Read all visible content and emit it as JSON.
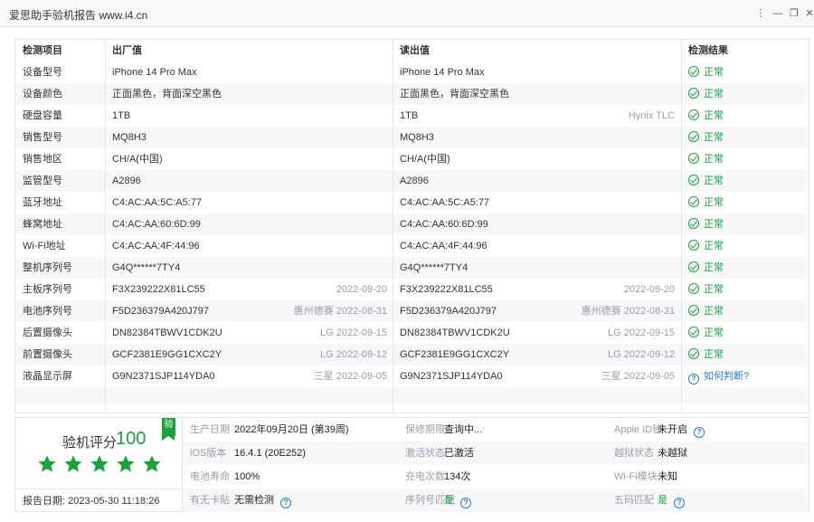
{
  "window": {
    "title": "爱思助手验机报告 www.i4.cn",
    "controls": [
      "⋮",
      "—",
      "❐",
      "✕"
    ]
  },
  "table": {
    "headers": {
      "item": "检测项目",
      "factory": "出厂值",
      "read": "读出值",
      "result": "检测结果"
    },
    "rows": [
      {
        "item": "设备型号",
        "factory": "iPhone 14 Pro Max",
        "factory_note": "",
        "read": "iPhone 14 Pro Max",
        "read_note": "",
        "result": "正常",
        "status": "ok"
      },
      {
        "item": "设备颜色",
        "factory": "正面黑色，背面深空黑色",
        "factory_note": "",
        "read": "正面黑色，背面深空黑色",
        "read_note": "",
        "result": "正常",
        "status": "ok"
      },
      {
        "item": "硬盘容量",
        "factory": "1TB",
        "factory_note": "",
        "read": "1TB",
        "read_note": "Hynix TLC",
        "result": "正常",
        "status": "ok"
      },
      {
        "item": "销售型号",
        "factory": "MQ8H3",
        "factory_note": "",
        "read": "MQ8H3",
        "read_note": "",
        "result": "正常",
        "status": "ok"
      },
      {
        "item": "销售地区",
        "factory": "CH/A(中国)",
        "factory_note": "",
        "read": "CH/A(中国)",
        "read_note": "",
        "result": "正常",
        "status": "ok"
      },
      {
        "item": "监管型号",
        "factory": "A2896",
        "factory_note": "",
        "read": "A2896",
        "read_note": "",
        "result": "正常",
        "status": "ok"
      },
      {
        "item": "蓝牙地址",
        "factory": "C4:AC:AA:5C:A5:77",
        "factory_note": "",
        "read": "C4:AC:AA:5C:A5:77",
        "read_note": "",
        "result": "正常",
        "status": "ok"
      },
      {
        "item": "蜂窝地址",
        "factory": "C4:AC:AA:60:6D:99",
        "factory_note": "",
        "read": "C4:AC:AA:60:6D:99",
        "read_note": "",
        "result": "正常",
        "status": "ok"
      },
      {
        "item": "Wi-Fi地址",
        "factory": "C4:AC:AA:4F:44:96",
        "factory_note": "",
        "read": "C4:AC:AA:4F:44:96",
        "read_note": "",
        "result": "正常",
        "status": "ok"
      },
      {
        "item": "整机序列号",
        "factory": "G4Q******7TY4",
        "factory_note": "",
        "read": "G4Q******7TY4",
        "read_note": "",
        "result": "正常",
        "status": "ok"
      },
      {
        "item": "主板序列号",
        "factory": "F3X239222X81LC55",
        "factory_note": "2022-09-20",
        "read": "F3X239222X81LC55",
        "read_note": "2022-09-20",
        "result": "正常",
        "status": "ok"
      },
      {
        "item": "电池序列号",
        "factory": "F5D236379A420J797",
        "factory_note": "惠州德赛 2022-08-31",
        "read": "F5D236379A420J797",
        "read_note": "惠州德赛 2022-08-31",
        "result": "正常",
        "status": "ok"
      },
      {
        "item": "后置摄像头",
        "factory": "DN82384TBWV1CDK2U",
        "factory_note": "LG 2022-09-15",
        "read": "DN82384TBWV1CDK2U",
        "read_note": "LG 2022-09-15",
        "result": "正常",
        "status": "ok"
      },
      {
        "item": "前置摄像头",
        "factory": "GCF2381E9GG1CXC2Y",
        "factory_note": "LG 2022-09-12",
        "read": "GCF2381E9GG1CXC2Y",
        "read_note": "LG 2022-09-12",
        "result": "正常",
        "status": "ok"
      },
      {
        "item": "液晶显示屏",
        "factory": "G9N2371SJP114YDA0",
        "factory_note": "三星 2022-09-05",
        "read": "G9N2371SJP114YDA0",
        "read_note": "三星 2022-09-05",
        "result": "如何判断?",
        "status": "help"
      }
    ]
  },
  "summary": {
    "score_label": "验机评分",
    "score_value": "100",
    "badge": "验",
    "stars": 5,
    "report_date_label": "报告日期:",
    "report_date": "2023-05-30 11:18:26",
    "fields": [
      {
        "label": "生产日期",
        "value": "2022年09月20日 (第39周)",
        "help": false
      },
      {
        "label": "保修期限",
        "value": "查询中...",
        "help": false
      },
      {
        "label": "Apple ID锁",
        "value": "未开启",
        "help": true
      },
      {
        "label": "iOS版本",
        "value": "16.4.1 (20E252)",
        "help": false
      },
      {
        "label": "激活状态",
        "value": "已激活",
        "help": false
      },
      {
        "label": "越狱状态",
        "value": "未越狱",
        "help": false
      },
      {
        "label": "电池寿命",
        "value": "100%",
        "help": false
      },
      {
        "label": "充电次数",
        "value": "134次",
        "help": false
      },
      {
        "label": "Wi-Fi模块",
        "value": "未知",
        "help": false
      },
      {
        "label": "有无卡贴",
        "value": "无需检测",
        "help": true
      },
      {
        "label": "序列号匹配",
        "value": "是",
        "help": true,
        "green": true
      },
      {
        "label": "五码匹配",
        "value": "是",
        "help": true,
        "green": true
      }
    ]
  },
  "colors": {
    "ok": "#1aa33a",
    "link": "#2a7bd6",
    "muted": "#9a9ea6",
    "alt_row": "#f6f7f9"
  }
}
